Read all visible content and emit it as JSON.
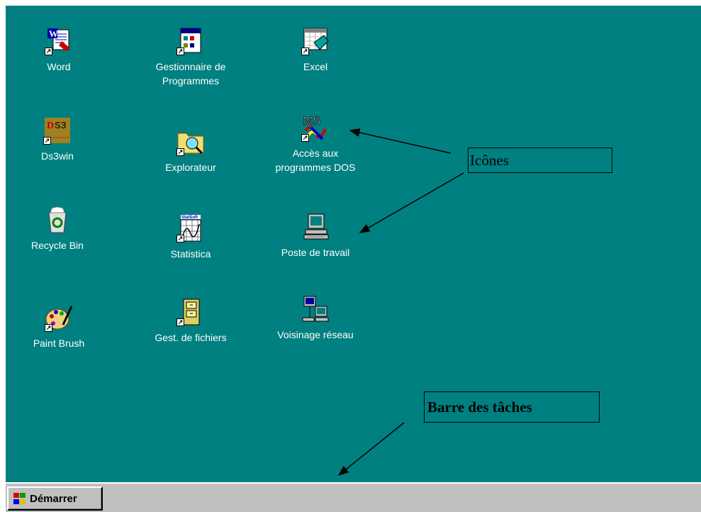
{
  "desktop": {
    "icons": [
      {
        "label": "Word",
        "icon": "word-icon"
      },
      {
        "label": "Gestionnaire de\nProgrammes",
        "icon": "program-manager-icon"
      },
      {
        "label": "Excel",
        "icon": "excel-icon"
      },
      {
        "label": "Ds3win",
        "icon": "ds3win-icon"
      },
      {
        "label": "Explorateur",
        "icon": "explorer-icon"
      },
      {
        "label": "Accès aux\nprogrammes DOS",
        "icon": "ms-dos-icon"
      },
      {
        "label": "Recycle Bin",
        "icon": "recycle-bin-icon"
      },
      {
        "label": "Statistica",
        "icon": "statistica-icon"
      },
      {
        "label": "Poste de travail",
        "icon": "my-computer-icon"
      },
      {
        "label": "Paint Brush",
        "icon": "paintbrush-icon"
      },
      {
        "label": "Gest. de fichiers",
        "icon": "file-manager-icon"
      },
      {
        "label": "Voisinage réseau",
        "icon": "network-neighborhood-icon"
      }
    ]
  },
  "annotations": {
    "icons_label": "Icônes",
    "taskbar_label": "Barre des tâches"
  },
  "taskbar": {
    "start_label": "Démarrer"
  },
  "colors": {
    "desktop": "#008080",
    "taskbar": "#c0c0c0"
  }
}
